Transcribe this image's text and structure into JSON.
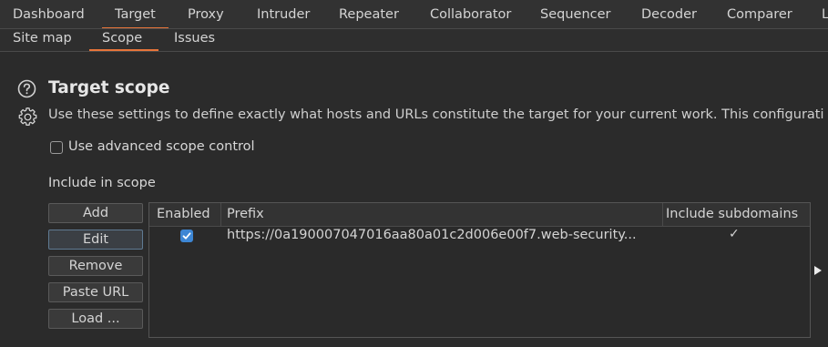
{
  "tabs": [
    "Dashboard",
    "Target",
    "Proxy",
    "Intruder",
    "Repeater",
    "Collaborator",
    "Sequencer",
    "Decoder",
    "Comparer",
    "L"
  ],
  "active_tab": "Target",
  "subtabs": [
    "Site map",
    "Scope",
    "Issues"
  ],
  "active_subtab": "Scope",
  "scope": {
    "title": "Target scope",
    "description": "Use these settings to define exactly what hosts and URLs constitute the target for your current work. This configurati",
    "advanced_label": "Use advanced scope control",
    "advanced_checked": false,
    "include_label": "Include in scope",
    "buttons": {
      "add": "Add",
      "edit": "Edit",
      "remove": "Remove",
      "paste": "Paste URL",
      "load": "Load ..."
    },
    "table": {
      "headers": {
        "enabled": "Enabled",
        "prefix": "Prefix",
        "subdomains": "Include subdomains"
      },
      "rows": [
        {
          "enabled": true,
          "prefix": "https://0a190007047016aa80a01c2d006e00f7.web-security...",
          "subdomains": "✓"
        }
      ]
    }
  },
  "icons": {
    "help": "help-icon",
    "settings": "gear-icon",
    "expand": "expand-arrow-icon"
  },
  "colors": {
    "accent": "#e8753a",
    "checkbox": "#3d86d4",
    "background": "#2b2b2b"
  }
}
